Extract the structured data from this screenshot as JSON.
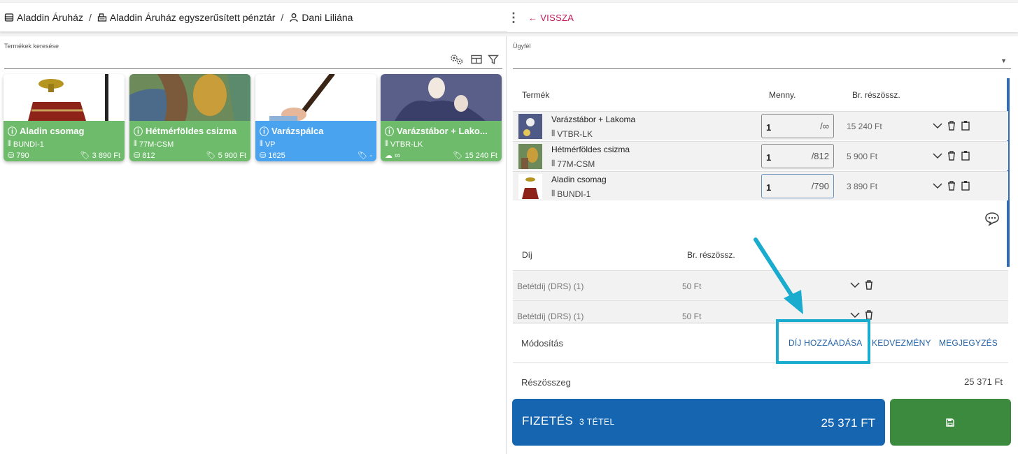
{
  "breadcrumb": [
    {
      "label": "Aladdin Áruház",
      "icon": "store-icon"
    },
    {
      "label": "Aladdin Áruház egyszerűsített pénztár",
      "icon": "register-icon"
    },
    {
      "label": "Dani Liliána",
      "icon": "person-icon"
    }
  ],
  "header": {
    "back_label": "← VISSZA"
  },
  "products_panel": {
    "search_label": "Termékek keresése",
    "tiles": [
      {
        "name": "Aladin csomag",
        "sku": "BUNDI-1",
        "stock": "790",
        "price": "3 890 Ft",
        "color": "#6dbb6b"
      },
      {
        "name": "Hétmérföldes csizma",
        "sku": "77M-CSM",
        "stock": "812",
        "price": "5 900 Ft",
        "color": "#6dbb6b"
      },
      {
        "name": "Varázspálca",
        "sku": "VP",
        "stock": "1625",
        "price": "-",
        "color": "#4aa3ee"
      },
      {
        "name": "Varázstábor + Lako...",
        "sku": "VTBR-LK",
        "stock": "∞",
        "price": "15 240 Ft",
        "color": "#6dbb6b"
      }
    ]
  },
  "cart": {
    "customer_label": "Ügyfél",
    "headers": {
      "product": "Termék",
      "qty": "Menny.",
      "subtotal": "Br. részössz."
    },
    "items": [
      {
        "name": "Varázstábor + Lakoma",
        "sku": "VTBR-LK",
        "qty": "1",
        "max": "/∞",
        "price": "15 240 Ft"
      },
      {
        "name": "Hétmérföldes csizma",
        "sku": "77M-CSM",
        "qty": "1",
        "max": "/812",
        "price": "5 900 Ft"
      },
      {
        "name": "Aladin csomag",
        "sku": "BUNDI-1",
        "qty": "1",
        "max": "/790",
        "price": "3 890 Ft"
      }
    ],
    "fee_headers": {
      "fee": "Díj",
      "subtotal": "Br. részössz."
    },
    "fees": [
      {
        "name": "Betétdíj (DRS) (1)",
        "price": "50 Ft"
      },
      {
        "name": "Betétdíj (DRS) (1)",
        "price": "50 Ft"
      }
    ],
    "modify_label": "Módosítás",
    "add_fee_label": "DÍJ HOZZÁADÁSA",
    "discount_label": "KEDVEZMÉNY",
    "note_label": "MEGJEGYZÉS",
    "subtotal_label": "Részösszeg",
    "subtotal_value": "25 371 Ft",
    "pay_label": "FIZETÉS",
    "pay_count": "3 TÉTEL",
    "pay_amount": "25 371 FT"
  },
  "colors": {
    "pay": "#1565b0",
    "save": "#3b8a3e",
    "highlight": "#1aaccf",
    "back": "#c2185b"
  }
}
